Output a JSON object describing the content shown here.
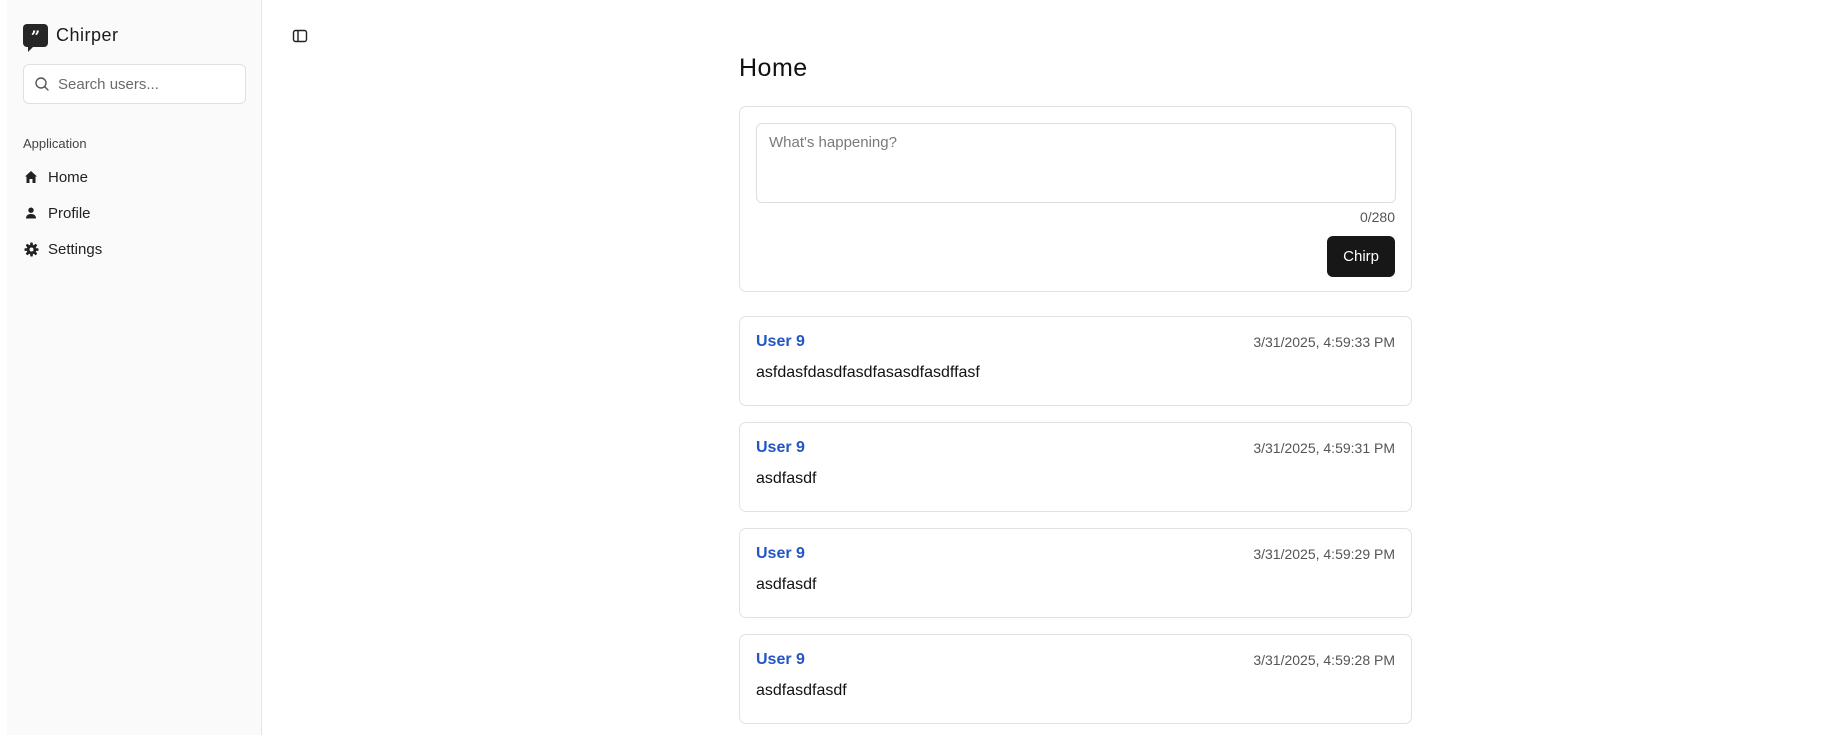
{
  "app": {
    "name": "Chirper"
  },
  "search": {
    "placeholder": "Search users..."
  },
  "sidebar": {
    "group_label": "Application",
    "items": [
      {
        "label": "Home",
        "icon": "home-icon"
      },
      {
        "label": "Profile",
        "icon": "user-icon"
      },
      {
        "label": "Settings",
        "icon": "gear-icon"
      }
    ]
  },
  "page": {
    "title": "Home"
  },
  "composer": {
    "placeholder": "What's happening?",
    "counter": "0/280",
    "submit_label": "Chirp"
  },
  "posts": [
    {
      "user": "User 9",
      "time": "3/31/2025, 4:59:33 PM",
      "text": "asfdasfdasdfasdfasasdfasdffasf"
    },
    {
      "user": "User 9",
      "time": "3/31/2025, 4:59:31 PM",
      "text": "asdfasdf"
    },
    {
      "user": "User 9",
      "time": "3/31/2025, 4:59:29 PM",
      "text": "asdfasdf"
    },
    {
      "user": "User 9",
      "time": "3/31/2025, 4:59:28 PM",
      "text": "asdfasdfasdf"
    }
  ],
  "colors": {
    "link": "#2356c4",
    "button": "#171717",
    "sidebar_bg": "#fafafa"
  }
}
